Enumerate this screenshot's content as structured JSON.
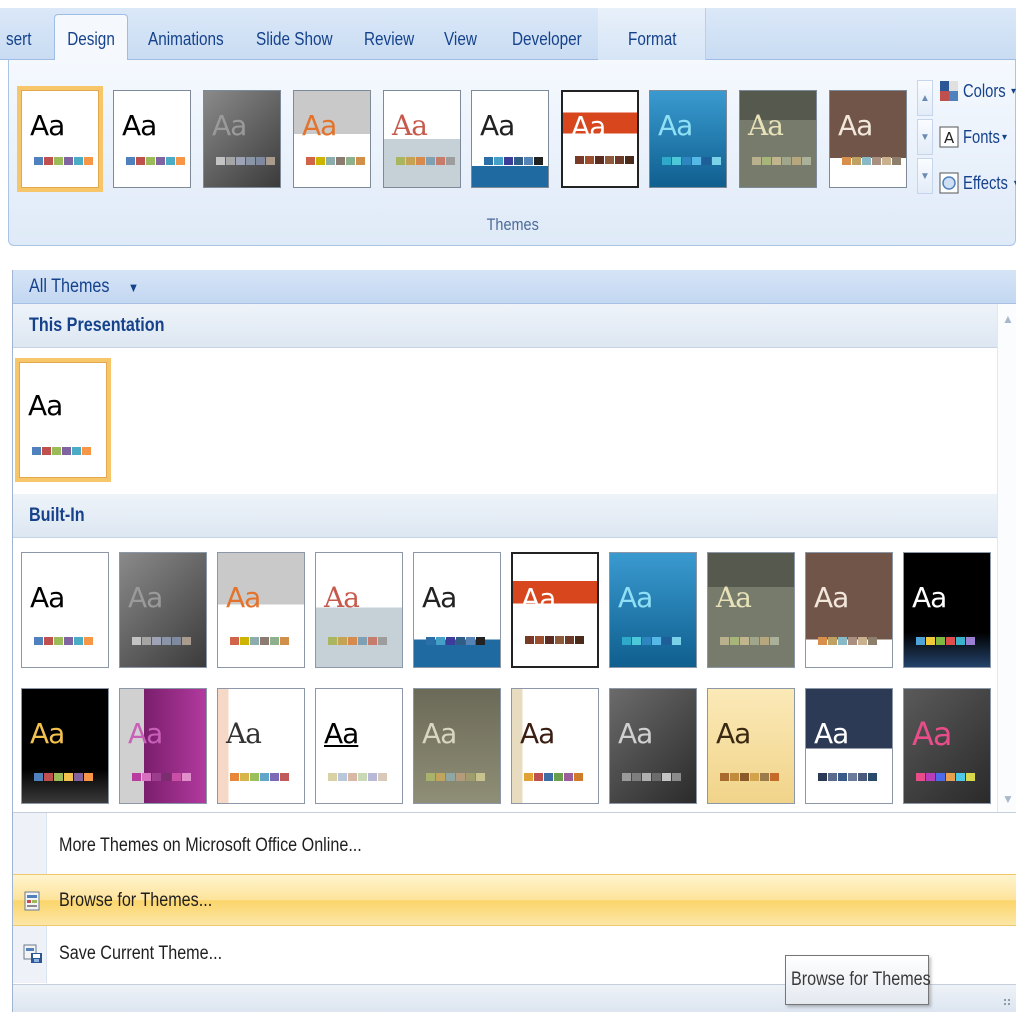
{
  "ribbon": {
    "tabs": [
      "sert",
      "Design",
      "Animations",
      "Slide Show",
      "Review",
      "View",
      "Developer",
      "Format"
    ],
    "active_tab": "Design",
    "group_label": "Themes",
    "commands": {
      "colors": "Colors",
      "fonts": "Fonts",
      "effects": "Effects"
    }
  },
  "gallery": {
    "header": "All Themes",
    "section_this": "This Presentation",
    "section_builtin": "Built-In",
    "thumb_text": "Aa",
    "menu": {
      "more_themes": "More Themes on Microsoft Office Online...",
      "browse": "Browse for Themes...",
      "save": "Save Current Theme..."
    },
    "tooltip": "Browse for Themes"
  },
  "colors": {
    "accent_hover": "#fbd56b",
    "selected_outline": "#f7c66b",
    "tab_text": "#15428b"
  }
}
